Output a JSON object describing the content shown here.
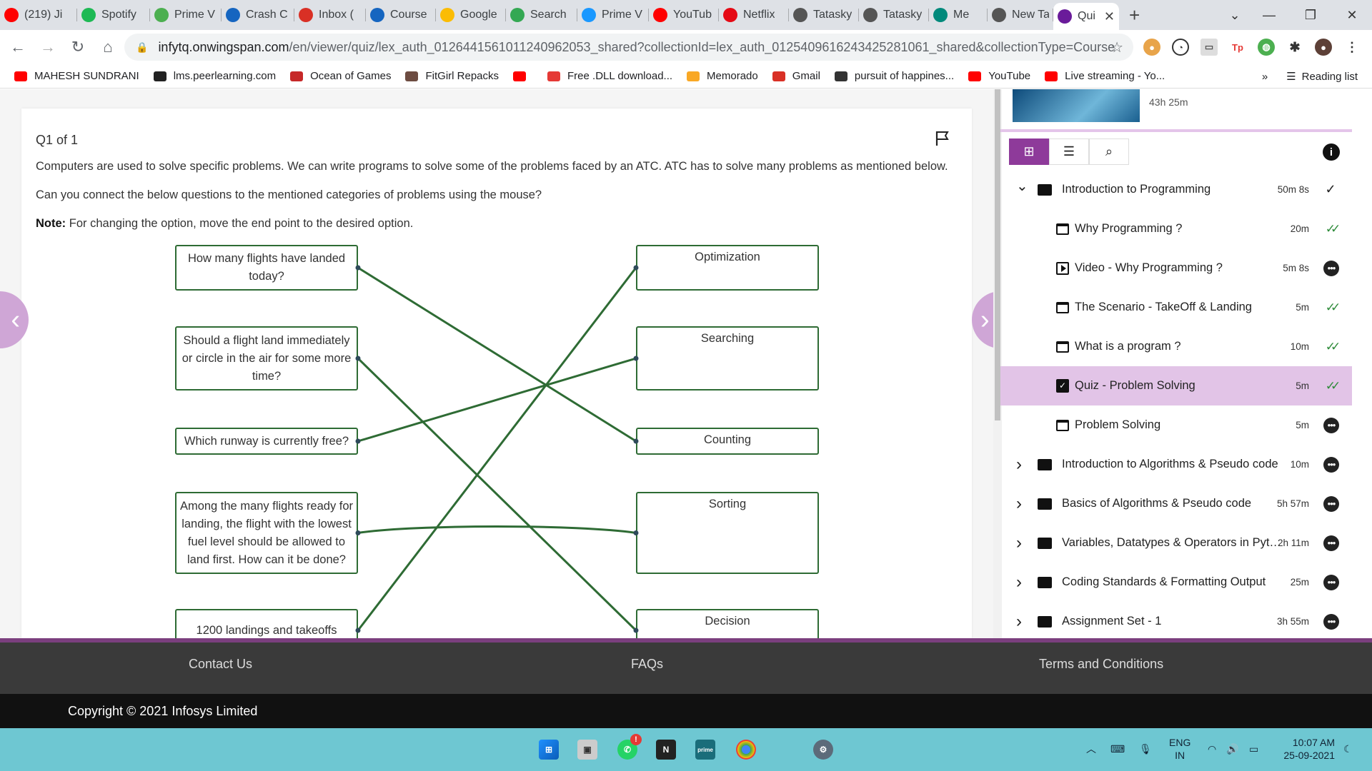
{
  "browser": {
    "tabs": [
      {
        "label": "(219) Ji",
        "icon": "youtube-icon",
        "color": "#ff0000"
      },
      {
        "label": "Spotify",
        "icon": "spotify-icon",
        "color": "#1db954"
      },
      {
        "label": "Prime V",
        "icon": "play-icon",
        "color": "#4caf50"
      },
      {
        "label": "Crash C",
        "icon": "course-icon",
        "color": "#1565c0"
      },
      {
        "label": "Inbox (",
        "icon": "gmail-icon",
        "color": "#d93025"
      },
      {
        "label": "Course",
        "icon": "course-icon",
        "color": "#1565c0"
      },
      {
        "label": "Google",
        "icon": "keep-icon",
        "color": "#fbbc04"
      },
      {
        "label": "Search",
        "icon": "search-tab-icon",
        "color": "#34a853"
      },
      {
        "label": "Prime V",
        "icon": "prime-icon",
        "color": "#1a98ff"
      },
      {
        "label": "YouTub",
        "icon": "youtube-icon",
        "color": "#ff0000"
      },
      {
        "label": "Netflix",
        "icon": "netflix-icon",
        "color": "#e50914"
      },
      {
        "label": "Tatasky",
        "icon": "globe-icon",
        "color": "#555555"
      },
      {
        "label": "Tatasky",
        "icon": "globe-icon",
        "color": "#555555"
      },
      {
        "label": "Me",
        "icon": "meet-icon",
        "color": "#00897b"
      },
      {
        "label": "New Ta",
        "icon": "newtab-icon",
        "color": "#555555"
      },
      {
        "label": "Qui",
        "icon": "quiz-icon",
        "color": "#6a1b9a"
      }
    ],
    "active_tab_index": 15,
    "url_host": "infytq.onwingspan.com",
    "url_path": "/en/viewer/quiz/lex_auth_012644156101124096​2053_shared?collectionId=lex_auth_012540961624342528​1061_shared&collectionType=Course",
    "bookmarks": [
      {
        "label": "MAHESH SUNDRANI",
        "color": "#ff0000"
      },
      {
        "label": "lms.peerlearning.com",
        "color": "#222222"
      },
      {
        "label": "Ocean of Games",
        "color": "#c62828"
      },
      {
        "label": "FitGirl Repacks",
        "color": "#6d4c41"
      },
      {
        "label": "",
        "color": "#ff0000"
      },
      {
        "label": "Free .DLL download...",
        "color": "#e53935"
      },
      {
        "label": "Memorado",
        "color": "#f9a825"
      },
      {
        "label": "Gmail",
        "color": "#d93025"
      },
      {
        "label": "pursuit of happines...",
        "color": "#333333"
      },
      {
        "label": "YouTube",
        "color": "#ff0000"
      },
      {
        "label": "Live streaming - Yo...",
        "color": "#ff0000"
      }
    ],
    "reading_list": "Reading list",
    "more_bookmarks": "»"
  },
  "quiz": {
    "counter": "Q1 of 1",
    "text1": "Computers are used to solve specific problems. We can write programs to solve some of the problems faced by an ATC. ATC has to solve many problems as mentioned below.",
    "text2": "Can you connect the below questions to the mentioned categories of problems using the mouse?",
    "note_label": "Note:",
    "note_text": " For changing the option, move the end point to the desired option.",
    "questions": [
      "How many flights have landed today?",
      "Should a flight land immediately or circle in the air for some more time?",
      "Which runway is currently free?",
      "Among the many flights ready for landing, the flight with the lowest fuel level should be allowed to land first. How can it be done?",
      "1200 landings and takeoffs"
    ],
    "categories": [
      "Optimization",
      "Searching",
      "Counting",
      "Sorting",
      "Decision"
    ],
    "connections": [
      [
        0,
        2
      ],
      [
        1,
        4
      ],
      [
        2,
        1
      ],
      [
        3,
        3
      ],
      [
        4,
        0
      ]
    ],
    "line_color": "#2e6b34"
  },
  "sidebar": {
    "duration": "43h 25m",
    "items": [
      {
        "label": "Introduction to Programming",
        "duration": "50m 8s",
        "type": "folder",
        "expanded": true,
        "status": "check"
      },
      {
        "label": "Why Programming ?",
        "duration": "20m",
        "type": "page",
        "status": "done"
      },
      {
        "label": "Video - Why Programming ?",
        "duration": "5m 8s",
        "type": "video",
        "status": "pending"
      },
      {
        "label": "The Scenario - TakeOff & Landing",
        "duration": "5m",
        "type": "page",
        "status": "done"
      },
      {
        "label": "What is a program ?",
        "duration": "10m",
        "type": "page",
        "status": "done"
      },
      {
        "label": "Quiz - Problem Solving",
        "duration": "5m",
        "type": "quiz",
        "status": "done",
        "active": true
      },
      {
        "label": "Problem Solving",
        "duration": "5m",
        "type": "page",
        "status": "pending"
      },
      {
        "label": "Introduction to Algorithms & Pseudo code",
        "duration": "10m",
        "type": "folder",
        "status": "pending"
      },
      {
        "label": "Basics of Algorithms & Pseudo code",
        "duration": "5h 57m",
        "type": "folder",
        "status": "pending"
      },
      {
        "label": "Variables, Datatypes & Operators in Pyt…",
        "duration": "2h 11m",
        "type": "folder",
        "status": "pending"
      },
      {
        "label": "Coding Standards & Formatting Output",
        "duration": "25m",
        "type": "folder",
        "status": "pending"
      },
      {
        "label": "Assignment Set - 1",
        "duration": "3h 55m",
        "type": "folder",
        "status": "pending"
      }
    ]
  },
  "footer": {
    "contact": "Contact Us",
    "faqs": "FAQs",
    "terms": "Terms and Conditions",
    "copyright": "Copyright © 2021 Infosys Limited"
  },
  "taskbar": {
    "lang1": "ENG",
    "lang2": "IN",
    "time": "10:07 AM",
    "date": "25-09-2021"
  }
}
